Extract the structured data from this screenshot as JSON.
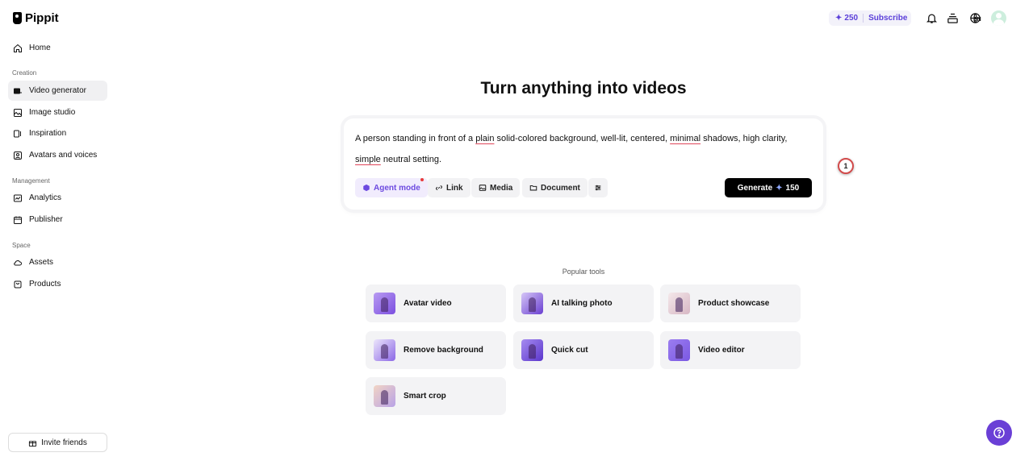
{
  "app": {
    "name": "Pippit"
  },
  "sidebar": {
    "home": "Home",
    "sections": {
      "creation": "Creation",
      "management": "Management",
      "space": "Space"
    },
    "creation_items": [
      "Video generator",
      "Image studio",
      "Inspiration",
      "Avatars and voices"
    ],
    "management_items": [
      "Analytics",
      "Publisher"
    ],
    "space_items": [
      "Assets",
      "Products"
    ],
    "active_item": "Video generator",
    "invite_label": "Invite friends"
  },
  "topbar": {
    "credits": "250",
    "subscribe": "Subscribe",
    "language": "EN"
  },
  "main": {
    "headline": "Turn anything into videos",
    "prompt": {
      "parts": [
        "A person standing in front of a ",
        "plain",
        " solid-colored background, well-lit, centered, ",
        "minimal",
        " shadows, high clarity, ",
        "simple",
        " neutral setting."
      ]
    },
    "chips": {
      "agent": "Agent mode",
      "link": "Link",
      "media": "Media",
      "document": "Document"
    },
    "generate_label": "Generate",
    "generate_cost": "150",
    "annotation_badge": "1",
    "popular_label": "Popular tools",
    "tools": [
      "Avatar video",
      "AI talking photo",
      "Product showcase",
      "Remove background",
      "Quick cut",
      "Video editor",
      "Smart crop"
    ]
  },
  "colors": {
    "accent": "#6a3fd6",
    "credits_text": "#5b3fd9",
    "generate_bg": "#000000",
    "active_nav_bg": "#f0f0f2"
  }
}
